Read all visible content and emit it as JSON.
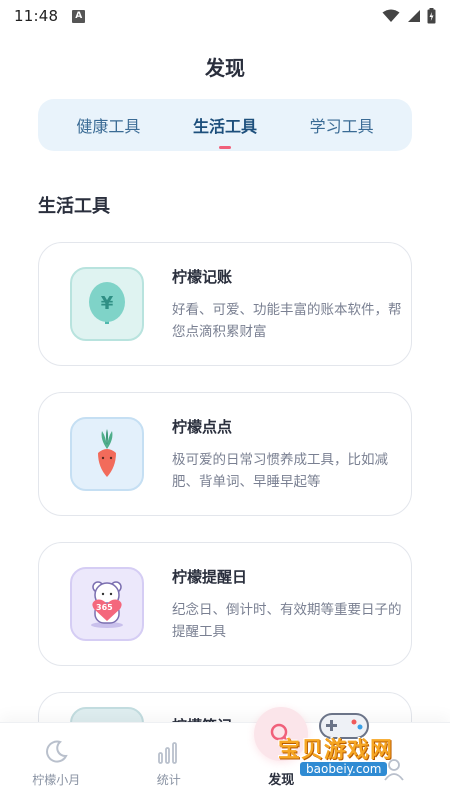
{
  "status_bar": {
    "time": "11:48",
    "notification_badge": "A"
  },
  "header": {
    "title": "发现"
  },
  "tabs": [
    {
      "label": "健康工具",
      "active": false
    },
    {
      "label": "生活工具",
      "active": true
    },
    {
      "label": "学习工具",
      "active": false
    }
  ],
  "section": {
    "title": "生活工具"
  },
  "cards": [
    {
      "title": "柠檬记账",
      "desc": "好看、可爱、功能丰富的账本软件，帮您点滴积累财富",
      "icon": "money-tree-icon"
    },
    {
      "title": "柠檬点点",
      "desc": "极可爱的日常习惯养成工具，比如减肥、背单词、早睡早起等",
      "icon": "radish-icon"
    },
    {
      "title": "柠檬提醒日",
      "desc": "纪念日、倒计时、有效期等重要日子的提醒工具",
      "icon": "bear-heart-icon",
      "badge": "365"
    },
    {
      "title": "柠檬笔记",
      "desc": "",
      "icon": "notes-icon"
    }
  ],
  "bottom_nav": [
    {
      "label": "柠檬小月",
      "icon": "moon-icon",
      "active": false
    },
    {
      "label": "统计",
      "icon": "bar-chart-icon",
      "active": false
    },
    {
      "label": "发现",
      "icon": "discover-icon",
      "active": true
    },
    {
      "label": "",
      "icon": "profile-icon",
      "active": false
    }
  ],
  "watermark": {
    "text": "宝贝游戏网",
    "url": "baobeiy.com"
  },
  "colors": {
    "accent": "#f0607a",
    "tab_bg": "#e9f3fb",
    "tab_text": "#3a6b95"
  }
}
